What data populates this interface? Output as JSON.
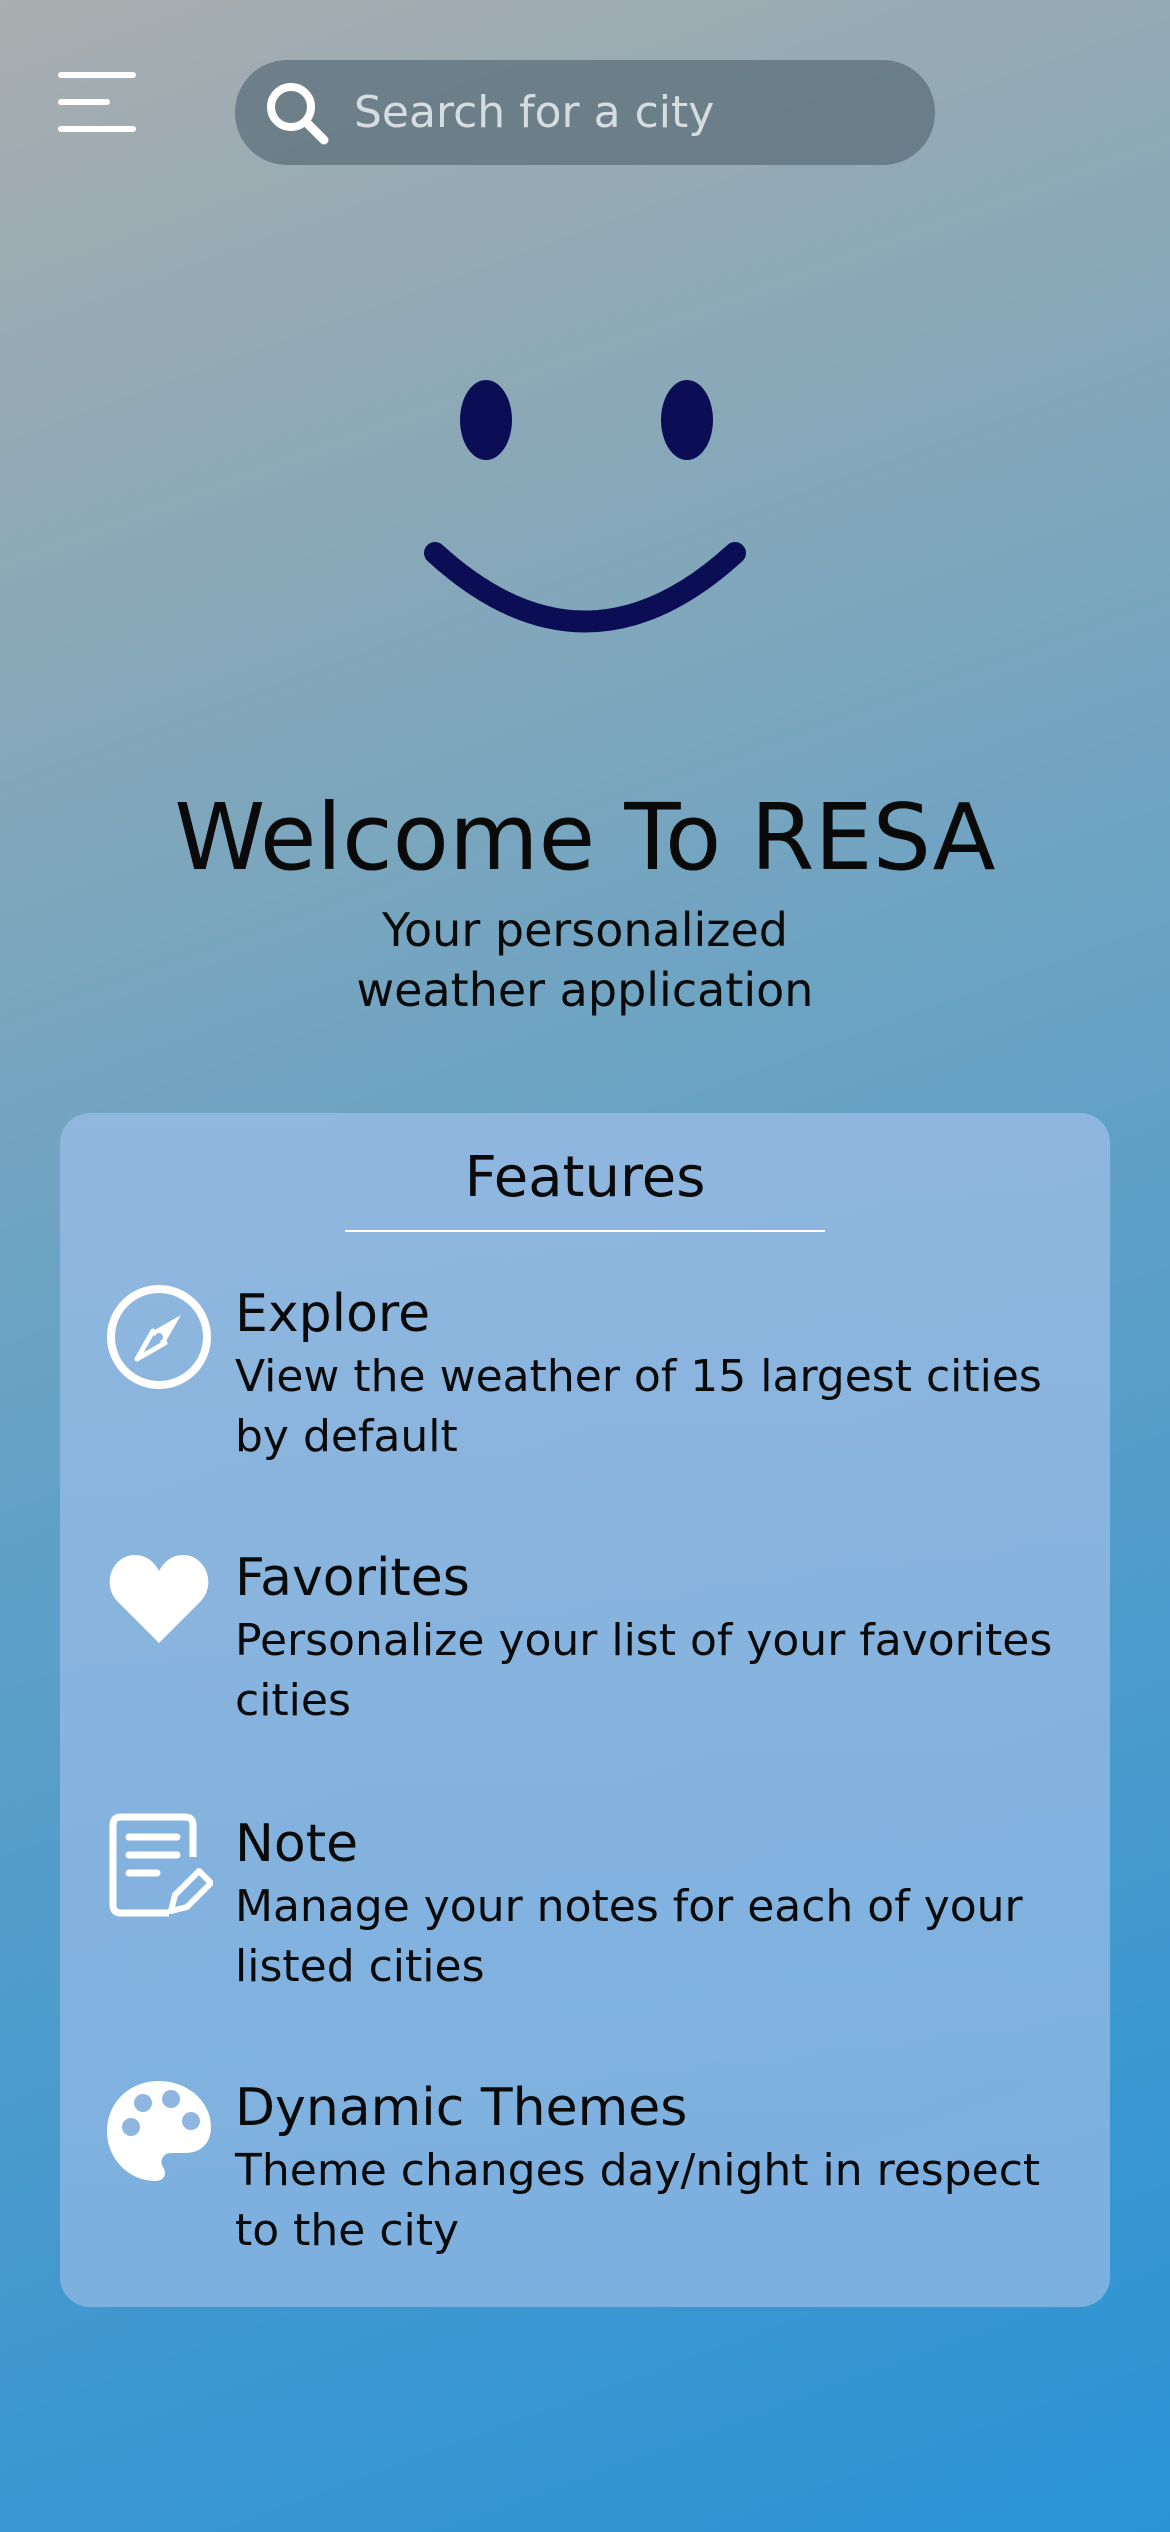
{
  "header": {
    "menu_icon": "hamburger-menu-icon",
    "search": {
      "placeholder": "Search for a city",
      "value": "",
      "icon": "search-icon"
    }
  },
  "hero": {
    "icon": "smiley-face-icon",
    "title": "Welcome To RESA",
    "tagline_line1": "Your personalized",
    "tagline_line2": "weather application"
  },
  "features": {
    "title": "Features",
    "items": [
      {
        "icon": "compass-icon",
        "name": "Explore",
        "description": "View the weather of 15 largest cities by default"
      },
      {
        "icon": "heart-icon",
        "name": "Favorites",
        "description": "Personalize your list of your favorites cities"
      },
      {
        "icon": "note-edit-icon",
        "name": "Note",
        "description": "Manage your notes for each of your listed cities"
      },
      {
        "icon": "palette-icon",
        "name": "Dynamic Themes",
        "description": "Theme changes day/night in respect to the city"
      }
    ]
  },
  "colors": {
    "smiley": "#0b0e55",
    "icon": "#ffffff",
    "text": "#0a0a0a"
  }
}
